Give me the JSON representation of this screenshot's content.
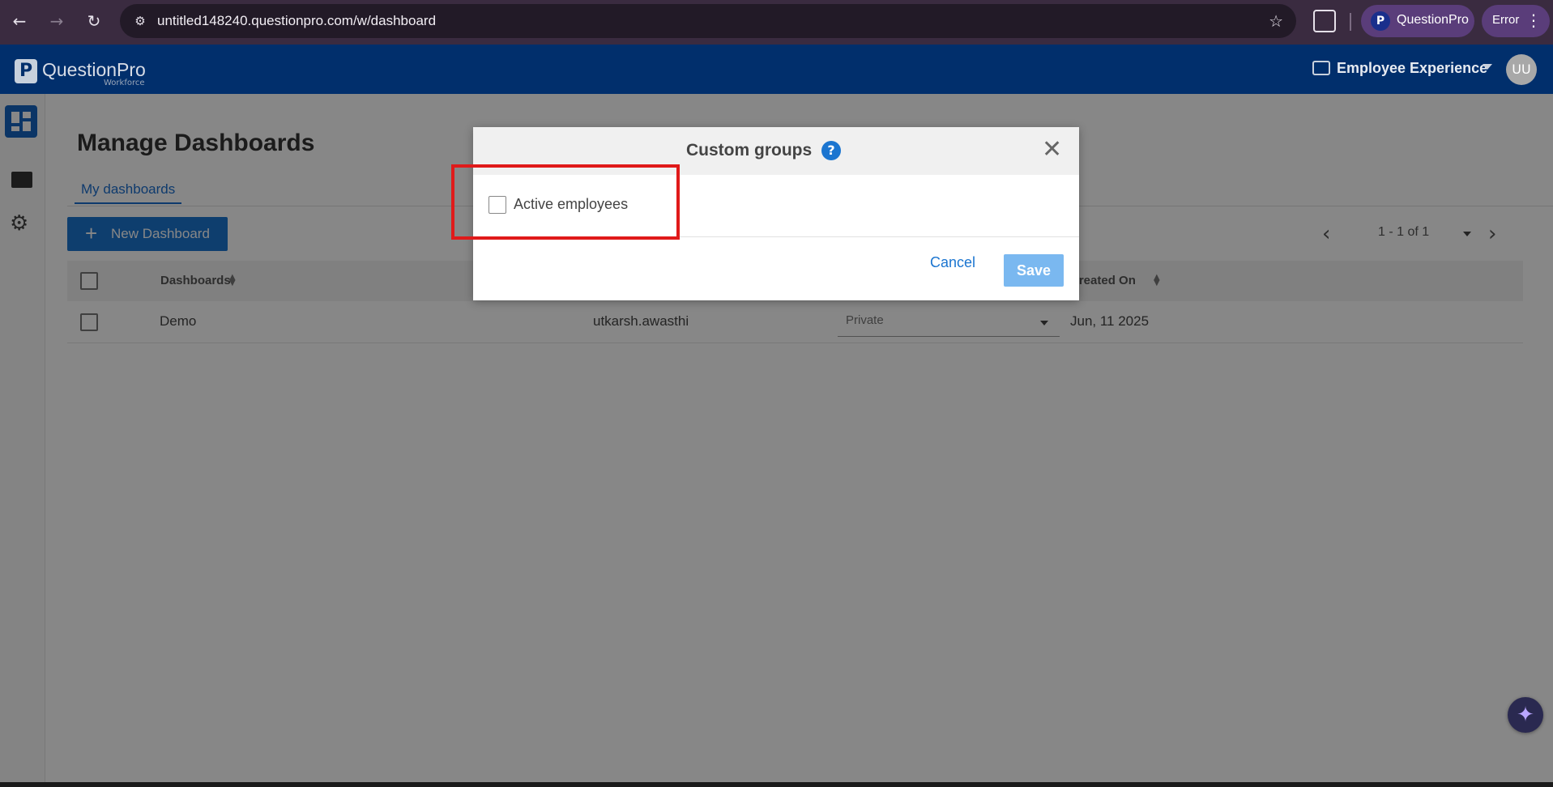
{
  "browser": {
    "url": "untitled148240.questionpro.com/w/dashboard",
    "profile_label": "QuestionPro",
    "profile_logo": "P",
    "error_label": "Error"
  },
  "header": {
    "logo_mark": "P",
    "logo_text": "QuestionPro",
    "logo_sub": "Workforce",
    "product_label": "Employee Experience",
    "avatar_initials": "UU"
  },
  "page": {
    "title": "Manage Dashboards",
    "tabs": [
      {
        "label": "My dashboards",
        "active": true
      }
    ],
    "new_button_label": "New Dashboard",
    "pagination_text": "1 - 1 of 1"
  },
  "table": {
    "columns": [
      "Dashboards",
      "Created On"
    ],
    "rows": [
      {
        "name": "Demo",
        "owner": "utkarsh.awasthi",
        "visibility": "Private",
        "created_on": "Jun, 11 2025"
      }
    ]
  },
  "modal": {
    "title": "Custom groups",
    "help": "?",
    "options": [
      {
        "label": "Active employees",
        "checked": false
      }
    ],
    "cancel_label": "Cancel",
    "save_label": "Save"
  },
  "colors": {
    "brand_navy": "#012f6c",
    "primary_blue": "#1b75d0",
    "highlight_red": "#e01a1a"
  },
  "icons": [
    "back-icon",
    "forward-icon",
    "reload-icon",
    "site-info-icon",
    "bookmark-star-icon",
    "extensions-icon",
    "menu-dots-icon",
    "dashboard-icon",
    "folder-icon",
    "settings-gear-icon",
    "help-icon",
    "close-icon",
    "sort-icon",
    "chevron-left-icon",
    "chevron-right-icon",
    "assistant-sparkle-icon"
  ]
}
